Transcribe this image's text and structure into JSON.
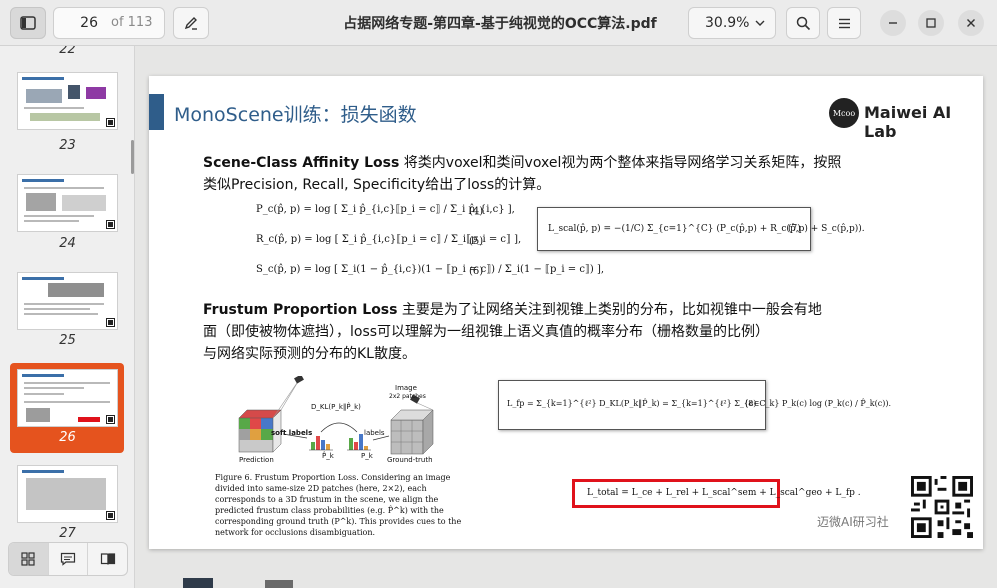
{
  "toolbar": {
    "current_page": "26",
    "total_pages": "of 113",
    "document_title": "占据网络专题-第四章-基于纯视觉的OCC算法.pdf",
    "zoom": "30.9%"
  },
  "sidebar": {
    "thumbnails": [
      {
        "number": "22"
      },
      {
        "number": "23"
      },
      {
        "number": "24"
      },
      {
        "number": "25"
      },
      {
        "number": "26",
        "selected": true
      },
      {
        "number": "27"
      }
    ],
    "selected_color": "#e5531e"
  },
  "slide": {
    "title": "MonoScene训练：损失函数",
    "logo_mark": "Mcoo",
    "logo_text": "Maiwei AI Lab",
    "para1_bold": "Scene-Class Affinity Loss",
    "para1_line1": " 将类内voxel和类间voxel视为两个整体来指导网络学习关系矩阵，按照",
    "para1_line2": "类似Precision, Recall, Specificity给出了loss的计算。",
    "para2_bold": "Frustum Proportion Loss",
    "para2_line1": " 主要是为了让网络关注到视锥上类别的分布，比如视锥中一般会有地",
    "para2_line2": "面（即使被物体遮挡），loss可以理解为一组视锥上语义真值的概率分布（栅格数量的比例）",
    "para2_line3": "与网络实际预测的分布的KL散度。",
    "eq4": "P_c(p̂, p) = log [ Σ_i p̂_{i,c}⟦p_i = c⟧ / Σ_i p̂_{i,c} ],",
    "eq4_num": "(4)",
    "eq5": "R_c(p̂, p) = log [ Σ_i p̂_{i,c}⟦p_i = c⟧ / Σ_i⟦p_i = c⟧ ],",
    "eq5_num": "(5)",
    "eq6": "S_c(p̂, p) = log [ Σ_i(1 − p̂_{i,c})(1 − ⟦p_i = c⟧) / Σ_i(1 − ⟦p_i = c⟧) ],",
    "eq6_num": "(6)",
    "eq7": "L_scal(p̂, p) = −(1/C) Σ_{c=1}^{C} (P_c(p̂,p) + R_c(p̂,p) + S_c(p̂,p)).",
    "eq7_num": "(7)",
    "eq8": "L_fp = Σ_{k=1}^{ℓ²} D_KL(P_k‖P̂_k) = Σ_{k=1}^{ℓ²} Σ_{c∈C_k} P_k(c) log (P_k(c) / P̂_k(c)).",
    "eq8_num": "(8)",
    "eq_total": "L_total = L_ce + L_rel + L_scal^sem + L_scal^geo + L_fp .",
    "figure_labels": {
      "image": "Image",
      "patches": "2x2 patches",
      "dkl": "D_KL(P_k‖P̂_k)",
      "soft_labels": "soft labels",
      "labels": "labels",
      "p_hat": "P̂_k",
      "p": "P_k",
      "prediction": "Prediction",
      "ground_truth": "Ground-truth"
    },
    "caption": "Figure 6. Frustum Proportion Loss. Considering an image divided into same-size 2D patches (here, 2×2), each corresponds to a 3D frustum in the scene, we align the predicted frustum class probabilities (e.g. P̂^k) with the corresponding ground truth (P^k). This provides cues to the network for occlusions disambiguation.",
    "watermark": "迈微AI研习社"
  }
}
